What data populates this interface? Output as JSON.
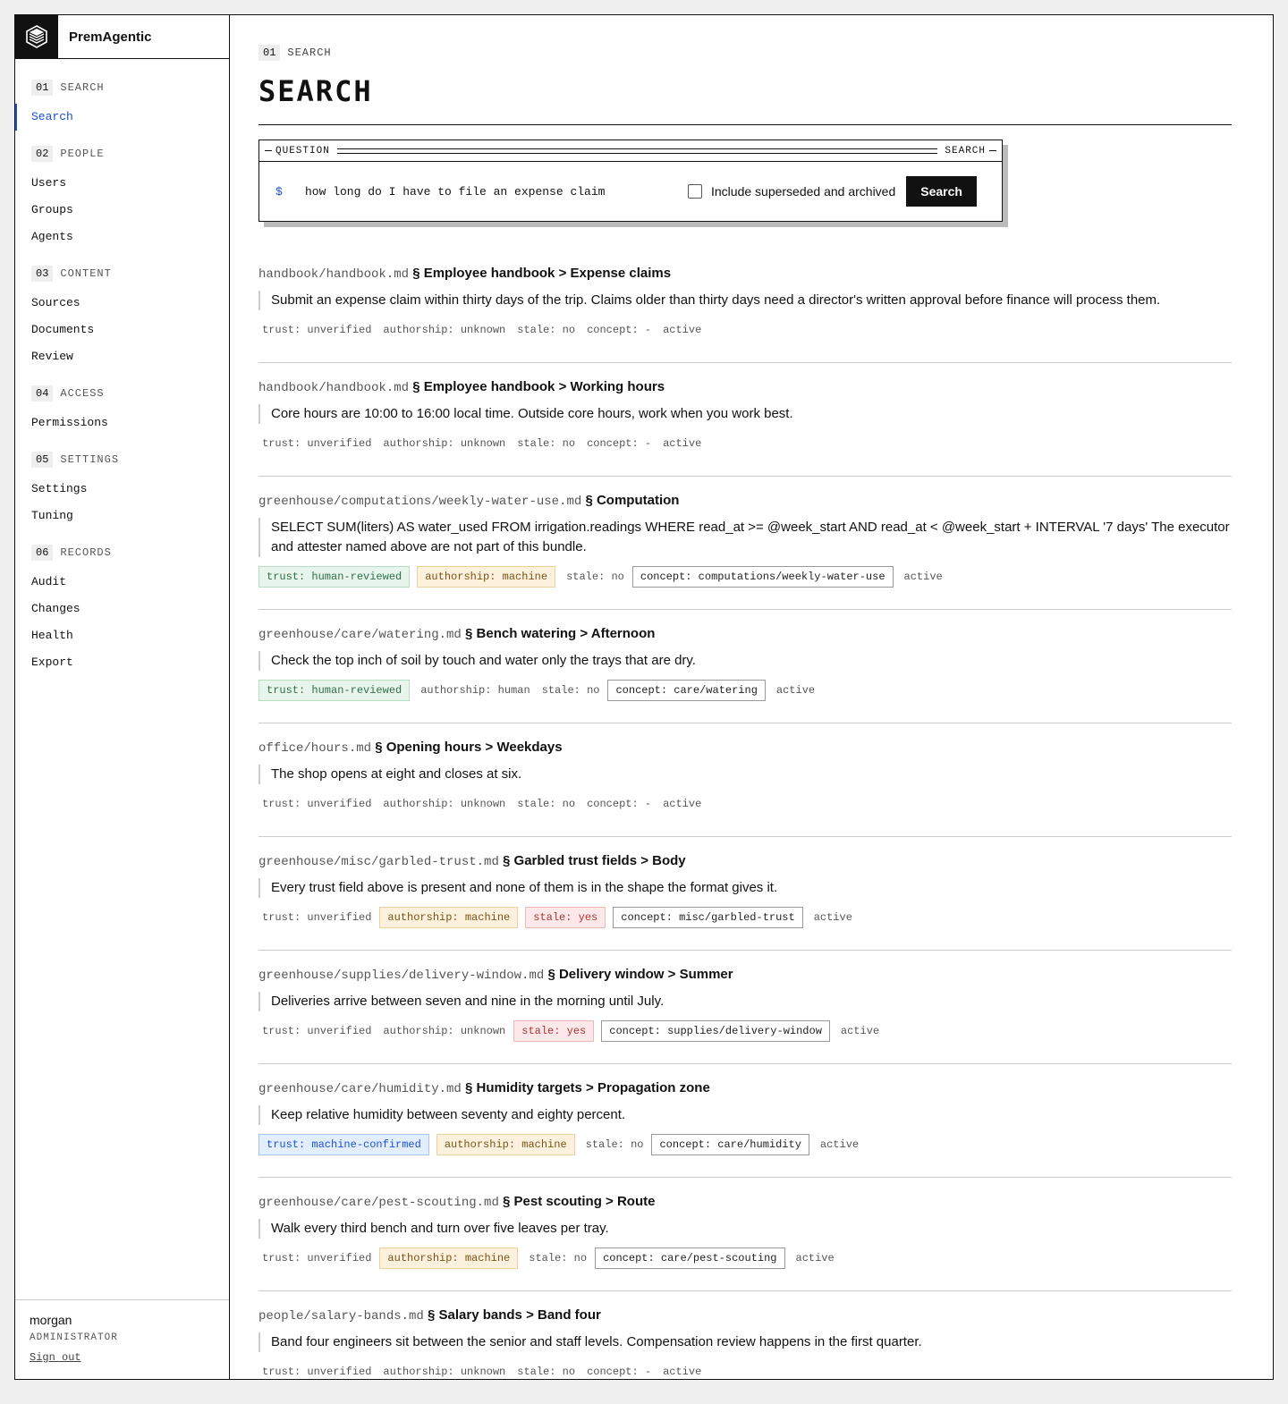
{
  "brand": {
    "name": "PremAgentic",
    "logo_icon": "stacked-layers-icon"
  },
  "nav": [
    {
      "num": "01",
      "label": "SEARCH",
      "items": [
        {
          "label": "Search",
          "active": true
        }
      ]
    },
    {
      "num": "02",
      "label": "PEOPLE",
      "items": [
        {
          "label": "Users"
        },
        {
          "label": "Groups"
        },
        {
          "label": "Agents"
        }
      ]
    },
    {
      "num": "03",
      "label": "CONTENT",
      "items": [
        {
          "label": "Sources"
        },
        {
          "label": "Documents"
        },
        {
          "label": "Review"
        }
      ]
    },
    {
      "num": "04",
      "label": "ACCESS",
      "items": [
        {
          "label": "Permissions"
        }
      ]
    },
    {
      "num": "05",
      "label": "SETTINGS",
      "items": [
        {
          "label": "Settings"
        },
        {
          "label": "Tuning"
        }
      ]
    },
    {
      "num": "06",
      "label": "RECORDS",
      "items": [
        {
          "label": "Audit"
        },
        {
          "label": "Changes"
        },
        {
          "label": "Health"
        },
        {
          "label": "Export"
        }
      ]
    }
  ],
  "user": {
    "name": "morgan",
    "role": "ADMINISTRATOR",
    "signout": "Sign out"
  },
  "page": {
    "crumb_num": "01",
    "crumb_label": "SEARCH",
    "title": "SEARCH"
  },
  "query_box": {
    "left_label": "QUESTION",
    "right_label": "SEARCH",
    "prompt": "$",
    "value": "how long do I have to file an expense claim",
    "checkbox_label": "Include superseded and archived",
    "checked": false,
    "button": "Search"
  },
  "colors": {
    "accent": "#1d4ed8",
    "ink": "#111111"
  },
  "results": [
    {
      "path": "handbook/handbook.md",
      "section": "§ Employee handbook > Expense claims",
      "text": "Submit an expense claim within thirty days of the trip. Claims older than thirty days need a director's written approval before finance will process them.",
      "tags": [
        {
          "text": "trust: unverified",
          "style": "plain"
        },
        {
          "text": "authorship: unknown",
          "style": "plain"
        },
        {
          "text": "stale: no",
          "style": "plain"
        },
        {
          "text": "concept: -",
          "style": "plain"
        },
        {
          "text": "active",
          "style": "plain"
        }
      ]
    },
    {
      "path": "handbook/handbook.md",
      "section": "§ Employee handbook > Working hours",
      "text": "Core hours are 10:00 to 16:00 local time. Outside core hours, work when you work best.",
      "tags": [
        {
          "text": "trust: unverified",
          "style": "plain"
        },
        {
          "text": "authorship: unknown",
          "style": "plain"
        },
        {
          "text": "stale: no",
          "style": "plain"
        },
        {
          "text": "concept: -",
          "style": "plain"
        },
        {
          "text": "active",
          "style": "plain"
        }
      ]
    },
    {
      "path": "greenhouse/computations/weekly-water-use.md",
      "section": "§ Computation",
      "text": "SELECT SUM(liters) AS water_used FROM irrigation.readings WHERE read_at >= @week_start AND read_at < @week_start + INTERVAL '7 days' The executor and attester named above are not part of this bundle.",
      "tags": [
        {
          "text": "trust: human-reviewed",
          "style": "green"
        },
        {
          "text": "authorship: machine",
          "style": "amber"
        },
        {
          "text": "stale: no",
          "style": "plain"
        },
        {
          "text": "concept: computations/weekly-water-use",
          "style": "box"
        },
        {
          "text": "active",
          "style": "plain"
        }
      ]
    },
    {
      "path": "greenhouse/care/watering.md",
      "section": "§ Bench watering > Afternoon",
      "text": "Check the top inch of soil by touch and water only the trays that are dry.",
      "tags": [
        {
          "text": "trust: human-reviewed",
          "style": "green"
        },
        {
          "text": "authorship: human",
          "style": "plain"
        },
        {
          "text": "stale: no",
          "style": "plain"
        },
        {
          "text": "concept: care/watering",
          "style": "box"
        },
        {
          "text": "active",
          "style": "plain"
        }
      ]
    },
    {
      "path": "office/hours.md",
      "section": "§ Opening hours > Weekdays",
      "text": "The shop opens at eight and closes at six.",
      "tags": [
        {
          "text": "trust: unverified",
          "style": "plain"
        },
        {
          "text": "authorship: unknown",
          "style": "plain"
        },
        {
          "text": "stale: no",
          "style": "plain"
        },
        {
          "text": "concept: -",
          "style": "plain"
        },
        {
          "text": "active",
          "style": "plain"
        }
      ]
    },
    {
      "path": "greenhouse/misc/garbled-trust.md",
      "section": "§ Garbled trust fields > Body",
      "text": "Every trust field above is present and none of them is in the shape the format gives it.",
      "tags": [
        {
          "text": "trust: unverified",
          "style": "plain"
        },
        {
          "text": "authorship: machine",
          "style": "amber"
        },
        {
          "text": "stale: yes",
          "style": "red"
        },
        {
          "text": "concept: misc/garbled-trust",
          "style": "box"
        },
        {
          "text": "active",
          "style": "plain"
        }
      ]
    },
    {
      "path": "greenhouse/supplies/delivery-window.md",
      "section": "§ Delivery window > Summer",
      "text": "Deliveries arrive between seven and nine in the morning until July.",
      "tags": [
        {
          "text": "trust: unverified",
          "style": "plain"
        },
        {
          "text": "authorship: unknown",
          "style": "plain"
        },
        {
          "text": "stale: yes",
          "style": "red"
        },
        {
          "text": "concept: supplies/delivery-window",
          "style": "box"
        },
        {
          "text": "active",
          "style": "plain"
        }
      ]
    },
    {
      "path": "greenhouse/care/humidity.md",
      "section": "§ Humidity targets > Propagation zone",
      "text": "Keep relative humidity between seventy and eighty percent.",
      "tags": [
        {
          "text": "trust: machine-confirmed",
          "style": "blue"
        },
        {
          "text": "authorship: machine",
          "style": "amber"
        },
        {
          "text": "stale: no",
          "style": "plain"
        },
        {
          "text": "concept: care/humidity",
          "style": "box"
        },
        {
          "text": "active",
          "style": "plain"
        }
      ]
    },
    {
      "path": "greenhouse/care/pest-scouting.md",
      "section": "§ Pest scouting > Route",
      "text": "Walk every third bench and turn over five leaves per tray.",
      "tags": [
        {
          "text": "trust: unverified",
          "style": "plain"
        },
        {
          "text": "authorship: machine",
          "style": "amber"
        },
        {
          "text": "stale: no",
          "style": "plain"
        },
        {
          "text": "concept: care/pest-scouting",
          "style": "box"
        },
        {
          "text": "active",
          "style": "plain"
        }
      ]
    },
    {
      "path": "people/salary-bands.md",
      "section": "§ Salary bands > Band four",
      "text": "Band four engineers sit between the senior and staff levels. Compensation review happens in the first quarter.",
      "tags": [
        {
          "text": "trust: unverified",
          "style": "plain"
        },
        {
          "text": "authorship: unknown",
          "style": "plain"
        },
        {
          "text": "stale: no",
          "style": "plain"
        },
        {
          "text": "concept: -",
          "style": "plain"
        },
        {
          "text": "active",
          "style": "plain"
        }
      ]
    }
  ]
}
